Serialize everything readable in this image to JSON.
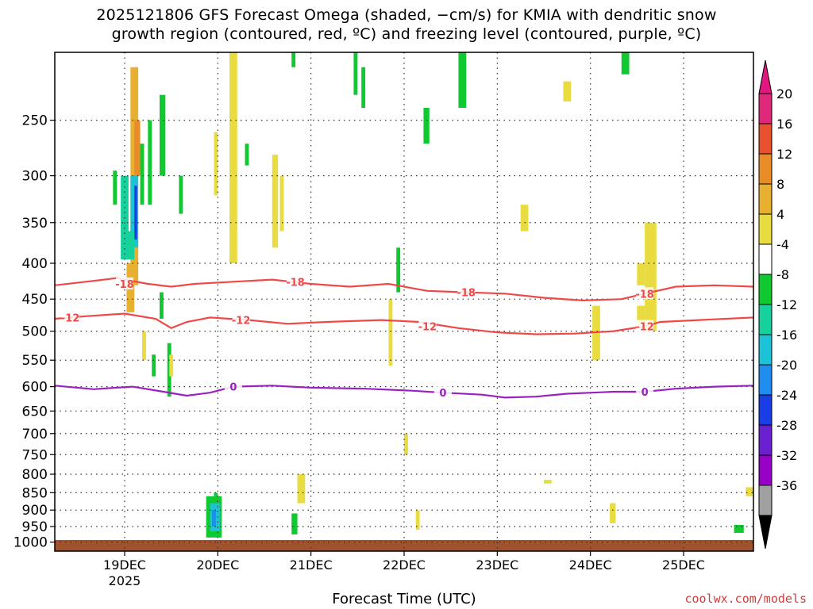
{
  "chart_data": {
    "type": "heatmap",
    "title_lines": [
      "2025121806 GFS Forecast Omega (shaded, −cm/s) for KMIA with dendritic snow",
      "growth region (contoured, red, ºC) and freezing level (contoured, purple, ºC)"
    ],
    "xlabel": "Forecast Time (UTC)",
    "credit": "coolwx.com/models",
    "x_ticks": [
      "19DEC",
      "20DEC",
      "21DEC",
      "22DEC",
      "23DEC",
      "24DEC",
      "25DEC"
    ],
    "x_year_label": "2025",
    "x_tick_hours": [
      18,
      42,
      66,
      90,
      114,
      138,
      162
    ],
    "x_range_hours": [
      0,
      180
    ],
    "y_ticks": [
      250,
      300,
      350,
      400,
      450,
      500,
      550,
      600,
      650,
      700,
      750,
      800,
      850,
      900,
      950,
      1000
    ],
    "y_range_hpa": [
      200,
      1030
    ],
    "grid": true,
    "colorbar": {
      "levels": [
        -36,
        -32,
        -28,
        -24,
        -20,
        -16,
        -12,
        -8,
        -4,
        4,
        8,
        12,
        16,
        20
      ],
      "colors": [
        "#a0a0a0",
        "#9800c8",
        "#6a1fd0",
        "#1a3ee6",
        "#1f8cf0",
        "#1cc3d6",
        "#16d19c",
        "#10c830",
        "#ffffff",
        "#e8dc40",
        "#e8b030",
        "#e88c28",
        "#e85030",
        "#e0287a"
      ],
      "below_color": "#000000",
      "above_color": "#e01880"
    },
    "contours": [
      {
        "name": "-18",
        "color": "#f04848",
        "points": [
          [
            0,
            430
          ],
          [
            8,
            425
          ],
          [
            16,
            420
          ],
          [
            24,
            428
          ],
          [
            30,
            432
          ],
          [
            36,
            428
          ],
          [
            46,
            425
          ],
          [
            56,
            422
          ],
          [
            66,
            428
          ],
          [
            76,
            432
          ],
          [
            86,
            428
          ],
          [
            96,
            438
          ],
          [
            106,
            440
          ],
          [
            116,
            442
          ],
          [
            126,
            448
          ],
          [
            136,
            452
          ],
          [
            146,
            450
          ],
          [
            152,
            442
          ],
          [
            160,
            432
          ],
          [
            170,
            430
          ],
          [
            180,
            432
          ]
        ],
        "labels_at": [
          [
            18,
            428
          ],
          [
            62,
            425
          ],
          [
            106,
            440
          ],
          [
            152,
            442
          ]
        ]
      },
      {
        "name": "-12",
        "color": "#f04848",
        "points": [
          [
            0,
            480
          ],
          [
            8,
            476
          ],
          [
            18,
            472
          ],
          [
            26,
            480
          ],
          [
            30,
            495
          ],
          [
            34,
            485
          ],
          [
            40,
            478
          ],
          [
            50,
            482
          ],
          [
            60,
            488
          ],
          [
            70,
            485
          ],
          [
            84,
            482
          ],
          [
            94,
            485
          ],
          [
            104,
            495
          ],
          [
            114,
            502
          ],
          [
            124,
            505
          ],
          [
            134,
            504
          ],
          [
            144,
            500
          ],
          [
            152,
            492
          ],
          [
            156,
            485
          ],
          [
            166,
            482
          ],
          [
            180,
            478
          ]
        ],
        "labels_at": [
          [
            4,
            478
          ],
          [
            48,
            482
          ],
          [
            96,
            492
          ],
          [
            152,
            492
          ]
        ]
      },
      {
        "name": "0",
        "color": "#9a20c0",
        "points": [
          [
            0,
            598
          ],
          [
            10,
            605
          ],
          [
            20,
            600
          ],
          [
            28,
            610
          ],
          [
            34,
            618
          ],
          [
            40,
            612
          ],
          [
            46,
            600
          ],
          [
            56,
            598
          ],
          [
            66,
            602
          ],
          [
            80,
            604
          ],
          [
            92,
            608
          ],
          [
            100,
            612
          ],
          [
            110,
            616
          ],
          [
            116,
            622
          ],
          [
            124,
            620
          ],
          [
            132,
            614
          ],
          [
            144,
            610
          ],
          [
            152,
            610
          ],
          [
            160,
            604
          ],
          [
            170,
            600
          ],
          [
            180,
            598
          ]
        ],
        "labels_at": [
          [
            46,
            600
          ],
          [
            100,
            612
          ],
          [
            152,
            610
          ]
        ]
      }
    ],
    "shaded_cells": [
      {
        "h0": 19.5,
        "h1": 21.5,
        "p0": 210,
        "p1": 430,
        "level": 8
      },
      {
        "h0": 20.5,
        "h1": 22,
        "p0": 250,
        "p1": 300,
        "level": 12
      },
      {
        "h0": 17,
        "h1": 19,
        "p0": 300,
        "p1": 395,
        "level": -12
      },
      {
        "h0": 19.5,
        "h1": 21.5,
        "p0": 300,
        "p1": 380,
        "level": -16
      },
      {
        "h0": 20.5,
        "h1": 21.2,
        "p0": 310,
        "p1": 370,
        "level": -24
      },
      {
        "h0": 17.5,
        "h1": 20.5,
        "p0": 360,
        "p1": 395,
        "level": -12
      },
      {
        "h0": 15,
        "h1": 16,
        "p0": 295,
        "p1": 330,
        "level": -8
      },
      {
        "h0": 22,
        "h1": 23,
        "p0": 270,
        "p1": 330,
        "level": -8
      },
      {
        "h0": 24,
        "h1": 25,
        "p0": 250,
        "p1": 330,
        "level": -8
      },
      {
        "h0": 27,
        "h1": 28.5,
        "p0": 230,
        "p1": 300,
        "level": -8
      },
      {
        "h0": 32,
        "h1": 33,
        "p0": 300,
        "p1": 340,
        "level": -8
      },
      {
        "h0": 18.5,
        "h1": 20.5,
        "p0": 400,
        "p1": 470,
        "level": 8
      },
      {
        "h0": 27,
        "h1": 28,
        "p0": 440,
        "p1": 480,
        "level": -8
      },
      {
        "h0": 29,
        "h1": 30,
        "p0": 520,
        "p1": 620,
        "level": -8
      },
      {
        "h0": 29.5,
        "h1": 30.5,
        "p0": 540,
        "p1": 580,
        "level": 4
      },
      {
        "h0": 22.5,
        "h1": 23.5,
        "p0": 500,
        "p1": 550,
        "level": 4
      },
      {
        "h0": 25,
        "h1": 26,
        "p0": 540,
        "p1": 580,
        "level": -8
      },
      {
        "h0": 45,
        "h1": 47,
        "p0": 200,
        "p1": 400,
        "level": 4
      },
      {
        "h0": 41,
        "h1": 42,
        "p0": 260,
        "p1": 320,
        "level": 4
      },
      {
        "h0": 49,
        "h1": 50,
        "p0": 270,
        "p1": 290,
        "level": -8
      },
      {
        "h0": 56,
        "h1": 57.5,
        "p0": 280,
        "p1": 380,
        "level": 4
      },
      {
        "h0": 58,
        "h1": 59,
        "p0": 300,
        "p1": 360,
        "level": 4
      },
      {
        "h0": 61,
        "h1": 62,
        "p0": 200,
        "p1": 210,
        "level": -8
      },
      {
        "h0": 77,
        "h1": 78,
        "p0": 200,
        "p1": 230,
        "level": -8
      },
      {
        "h0": 79,
        "h1": 80,
        "p0": 210,
        "p1": 240,
        "level": -8
      },
      {
        "h0": 88,
        "h1": 89,
        "p0": 380,
        "p1": 440,
        "level": -8
      },
      {
        "h0": 95,
        "h1": 96.5,
        "p0": 240,
        "p1": 270,
        "level": -8
      },
      {
        "h0": 104,
        "h1": 106,
        "p0": 200,
        "p1": 240,
        "level": -8
      },
      {
        "h0": 41,
        "h1": 42,
        "p0": 850,
        "p1": 860,
        "level": -8
      },
      {
        "h0": 39,
        "h1": 43,
        "p0": 860,
        "p1": 985,
        "level": -8
      },
      {
        "h0": 40,
        "h1": 42.5,
        "p0": 880,
        "p1": 965,
        "level": -16
      },
      {
        "h0": 40.5,
        "h1": 41.5,
        "p0": 900,
        "p1": 950,
        "level": -20
      },
      {
        "h0": 61,
        "h1": 62.5,
        "p0": 910,
        "p1": 975,
        "level": -8
      },
      {
        "h0": 62.5,
        "h1": 64.5,
        "p0": 800,
        "p1": 880,
        "level": 4
      },
      {
        "h0": 86,
        "h1": 87,
        "p0": 450,
        "p1": 560,
        "level": 4
      },
      {
        "h0": 90,
        "h1": 91,
        "p0": 700,
        "p1": 750,
        "level": 4
      },
      {
        "h0": 93,
        "h1": 94,
        "p0": 900,
        "p1": 960,
        "level": 4
      },
      {
        "h0": 120,
        "h1": 122,
        "p0": 330,
        "p1": 360,
        "level": 4
      },
      {
        "h0": 131,
        "h1": 133,
        "p0": 220,
        "p1": 235,
        "level": 4
      },
      {
        "h0": 138.5,
        "h1": 140.5,
        "p0": 460,
        "p1": 550,
        "level": 4
      },
      {
        "h0": 143,
        "h1": 144.5,
        "p0": 880,
        "p1": 940,
        "level": 4
      },
      {
        "h0": 146,
        "h1": 148,
        "p0": 200,
        "p1": 215,
        "level": -8
      },
      {
        "h0": 150,
        "h1": 152,
        "p0": 400,
        "p1": 430,
        "level": 4
      },
      {
        "h0": 152,
        "h1": 155,
        "p0": 350,
        "p1": 500,
        "level": 4
      },
      {
        "h0": 150,
        "h1": 152,
        "p0": 460,
        "p1": 490,
        "level": 4
      },
      {
        "h0": 126,
        "h1": 128,
        "p0": 815,
        "p1": 825,
        "level": 4
      },
      {
        "h0": 178,
        "h1": 180,
        "p0": 835,
        "p1": 860,
        "level": 4
      },
      {
        "h0": 175,
        "h1": 177.5,
        "p0": 945,
        "p1": 970,
        "level": -8
      }
    ]
  }
}
